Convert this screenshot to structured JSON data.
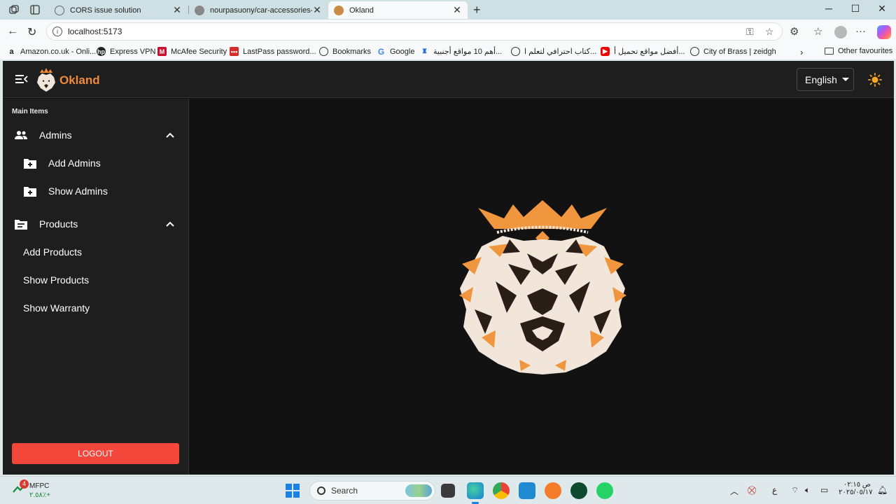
{
  "browser": {
    "tabs": [
      {
        "title": "CORS issue solution",
        "favicon": "globe-icon"
      },
      {
        "title": "nourpasuony/car-accessories-bac",
        "favicon": "github-icon"
      },
      {
        "title": "Okland",
        "favicon": "lion-icon"
      }
    ],
    "url": "localhost:5173",
    "bookmarks": [
      {
        "label": "Amazon.co.uk - Onli...",
        "icon": "amazon-icon"
      },
      {
        "label": "Express VPN",
        "icon": "hp-icon"
      },
      {
        "label": "McAfee Security",
        "icon": "mcafee-icon"
      },
      {
        "label": "LastPass password...",
        "icon": "lastpass-icon"
      },
      {
        "label": "Bookmarks",
        "icon": "globe-icon"
      },
      {
        "label": "Google",
        "icon": "google-icon"
      },
      {
        "label": "أهم 10 مواقع أجنبية...",
        "icon": "school-icon"
      },
      {
        "label": "كتاب احترافي لتعلم ا...",
        "icon": "globe-icon"
      },
      {
        "label": "أفضل مواقع تحميل أ...",
        "icon": "youtube-icon"
      },
      {
        "label": "City of Brass | zeidgh",
        "icon": "globe-icon"
      }
    ],
    "other_favourites": "Other favourites"
  },
  "app": {
    "brand": "Okland",
    "language": "English",
    "sidebar": {
      "section_title": "Main Items",
      "groups": [
        {
          "label": "Admins",
          "items": [
            "Add Admins",
            "Show Admins"
          ]
        },
        {
          "label": "Products",
          "items": [
            "Add Products",
            "Show Products",
            "Show Warranty"
          ]
        }
      ],
      "logout": "LOGOUT"
    },
    "colors": {
      "accent": "#f08a38",
      "logout": "#f2473a",
      "background": "#121212",
      "surface": "#1e1e1e"
    }
  },
  "taskbar": {
    "stock_name": "MFPC",
    "stock_value": "٢.٥٨٪+",
    "notification_count": "4",
    "search_placeholder": "Search",
    "lang_indicator": "ع",
    "time": "ص ٠٢:١٥",
    "date": "٢٠٢٥/٠٥/١٧"
  }
}
